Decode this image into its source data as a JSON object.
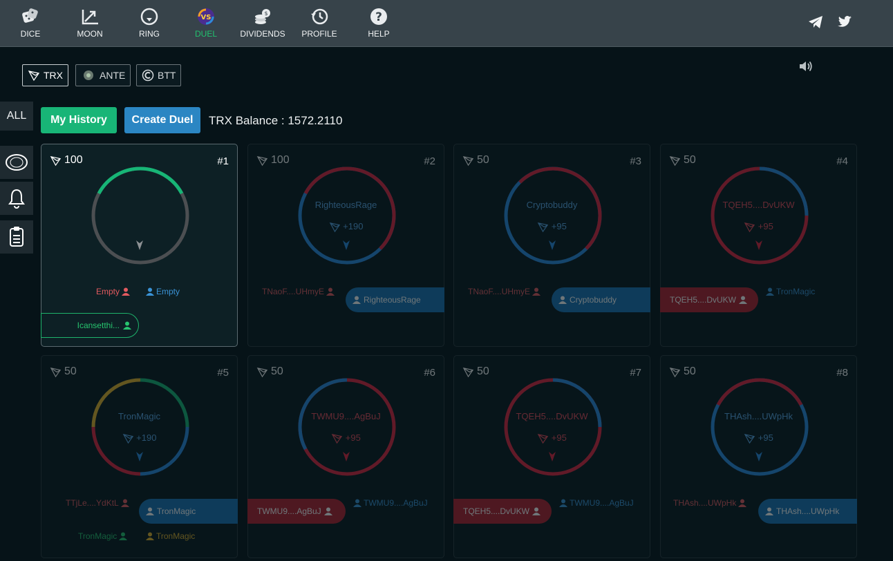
{
  "nav": {
    "items": [
      {
        "label": "DICE",
        "icon": "dice-icon"
      },
      {
        "label": "MOON",
        "icon": "moon-chart-icon"
      },
      {
        "label": "RING",
        "icon": "ring-icon"
      },
      {
        "label": "DUEL",
        "icon": "vs-icon"
      },
      {
        "label": "DIVIDENDS",
        "icon": "coins-icon"
      },
      {
        "label": "PROFILE",
        "icon": "history-icon"
      },
      {
        "label": "HELP",
        "icon": "help-icon"
      }
    ],
    "active": "DUEL",
    "social": [
      "telegram-icon",
      "twitter-icon"
    ]
  },
  "currencies": [
    {
      "label": "TRX",
      "icon": "tron-icon"
    },
    {
      "label": "ANTE",
      "icon": "ante-icon"
    },
    {
      "label": "BTT",
      "icon": "btt-icon"
    }
  ],
  "sidebar": {
    "all_label": "ALL",
    "icons": [
      "headset-icon",
      "bell-icon",
      "clipboard-icon"
    ]
  },
  "toolbar": {
    "history_label": "My History",
    "create_label": "Create Duel",
    "balance_text": "TRX Balance : 1572.2110"
  },
  "colors": {
    "green": "#18b577",
    "blue": "#2b86c3",
    "red": "#b3202f",
    "topbar": "#37434a"
  },
  "duels": [
    {
      "amount": "100",
      "number": "#1",
      "center_name": "",
      "win": "",
      "left": "Empty",
      "right": "Empty",
      "extra_left": "Icansetthi...",
      "extra_right": "",
      "state": "open"
    },
    {
      "amount": "100",
      "number": "#2",
      "center_name": "RighteousRage",
      "win": "+190",
      "left": "TNaoF....UHmyE",
      "right": "RighteousRage",
      "extra_left": "",
      "extra_right": "",
      "state": "blue-won"
    },
    {
      "amount": "50",
      "number": "#3",
      "center_name": "Cryptobuddy",
      "win": "+95",
      "left": "TNaoF....UHmyE",
      "right": "Cryptobuddy",
      "extra_left": "",
      "extra_right": "",
      "state": "blue-won"
    },
    {
      "amount": "50",
      "number": "#4",
      "center_name": "TQEH5....DvUKW",
      "win": "+95",
      "left": "TQEH5....DvUKW",
      "right": "TronMagic",
      "extra_left": "",
      "extra_right": "",
      "state": "red-won"
    },
    {
      "amount": "50",
      "number": "#5",
      "center_name": "TronMagic",
      "win": "+190",
      "left": "TTjLe....YdKtL",
      "right": "TronMagic",
      "extra_left": "TronMagic",
      "extra_right": "TronMagic",
      "state": "blue-won"
    },
    {
      "amount": "50",
      "number": "#6",
      "center_name": "TWMU9....AgBuJ",
      "win": "+95",
      "left": "TWMU9....AgBuJ",
      "right": "TWMU9....AgBuJ",
      "extra_left": "",
      "extra_right": "",
      "state": "red-won"
    },
    {
      "amount": "50",
      "number": "#7",
      "center_name": "TQEH5....DvUKW",
      "win": "+95",
      "left": "TQEH5....DvUKW",
      "right": "TWMU9....AgBuJ",
      "extra_left": "",
      "extra_right": "",
      "state": "red-won"
    },
    {
      "amount": "50",
      "number": "#8",
      "center_name": "THAsh....UWpHk",
      "win": "+95",
      "left": "THAsh....UWpHk",
      "right": "THAsh....UWpHk",
      "extra_left": "",
      "extra_right": "",
      "state": "blue-won"
    }
  ]
}
